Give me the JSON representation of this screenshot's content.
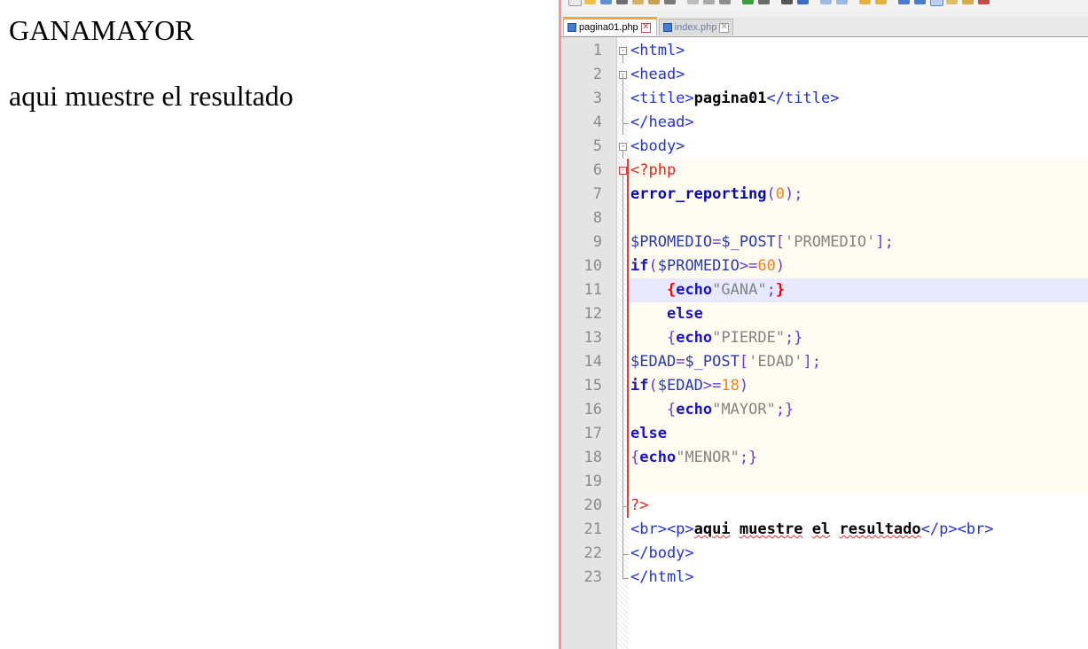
{
  "browser": {
    "output_text": "GANAMAYOR",
    "paragraph": "aqui muestre el resultado"
  },
  "editor": {
    "tabs": [
      {
        "label": "pagina01.php",
        "active": true
      },
      {
        "label": "index.php",
        "active": false
      }
    ],
    "close_glyph": "✕",
    "lines": [
      {
        "n": "1",
        "tokens": [
          [
            "tag",
            "<html>"
          ]
        ]
      },
      {
        "n": "2",
        "tokens": [
          [
            "tag",
            "<head>"
          ]
        ]
      },
      {
        "n": "3",
        "tokens": [
          [
            "tag",
            "<title>"
          ],
          [
            "bold",
            "pagina01"
          ],
          [
            "tag",
            "</title>"
          ]
        ]
      },
      {
        "n": "4",
        "tokens": [
          [
            "tag",
            "</head>"
          ]
        ]
      },
      {
        "n": "5",
        "tokens": [
          [
            "tag",
            "<body>"
          ]
        ]
      },
      {
        "n": "6",
        "tokens": [
          [
            "php",
            "<?php"
          ]
        ]
      },
      {
        "n": "7",
        "tokens": [
          [
            "fn",
            "error_reporting"
          ],
          [
            "op",
            "("
          ],
          [
            "num",
            "0"
          ],
          [
            "op",
            ");"
          ]
        ]
      },
      {
        "n": "8",
        "tokens": []
      },
      {
        "n": "9",
        "tokens": [
          [
            "var",
            "$PROMEDIO"
          ],
          [
            "op",
            "="
          ],
          [
            "var",
            "$_POST"
          ],
          [
            "op",
            "["
          ],
          [
            "str",
            "'PROMEDIO'"
          ],
          [
            "op",
            "];"
          ]
        ]
      },
      {
        "n": "10",
        "tokens": [
          [
            "kw",
            "if"
          ],
          [
            "op",
            "("
          ],
          [
            "var",
            "$PROMEDIO"
          ],
          [
            "op",
            ">="
          ],
          [
            "num",
            "60"
          ],
          [
            "op",
            ")"
          ]
        ]
      },
      {
        "n": "11",
        "tokens": [
          [
            "plain",
            "    "
          ],
          [
            "brace-red",
            "{"
          ],
          [
            "kw",
            "echo"
          ],
          [
            "str",
            "\"GANA\""
          ],
          [
            "op",
            ";"
          ],
          [
            "brace-red",
            "}"
          ]
        ]
      },
      {
        "n": "12",
        "tokens": [
          [
            "plain",
            "    "
          ],
          [
            "kw",
            "else"
          ]
        ]
      },
      {
        "n": "13",
        "tokens": [
          [
            "plain",
            "    "
          ],
          [
            "op",
            "{"
          ],
          [
            "kw",
            "echo"
          ],
          [
            "str",
            "\"PIERDE\""
          ],
          [
            "op",
            ";}"
          ]
        ]
      },
      {
        "n": "14",
        "tokens": [
          [
            "var",
            "$EDAD"
          ],
          [
            "op",
            "="
          ],
          [
            "var",
            "$_POST"
          ],
          [
            "op",
            "["
          ],
          [
            "str",
            "'EDAD'"
          ],
          [
            "op",
            "];"
          ]
        ]
      },
      {
        "n": "15",
        "tokens": [
          [
            "kw",
            "if"
          ],
          [
            "op",
            "("
          ],
          [
            "var",
            "$EDAD"
          ],
          [
            "op",
            ">="
          ],
          [
            "num",
            "18"
          ],
          [
            "op",
            ")"
          ]
        ]
      },
      {
        "n": "16",
        "tokens": [
          [
            "plain",
            "    "
          ],
          [
            "op",
            "{"
          ],
          [
            "kw",
            "echo"
          ],
          [
            "str",
            "\"MAYOR\""
          ],
          [
            "op",
            ";}"
          ]
        ]
      },
      {
        "n": "17",
        "tokens": [
          [
            "kw",
            "else"
          ]
        ]
      },
      {
        "n": "18",
        "tokens": [
          [
            "op",
            "{"
          ],
          [
            "kw",
            "echo"
          ],
          [
            "str",
            "\"MENOR\""
          ],
          [
            "op",
            ";}"
          ]
        ]
      },
      {
        "n": "19",
        "tokens": []
      },
      {
        "n": "20",
        "tokens": [
          [
            "php",
            "?>"
          ]
        ]
      },
      {
        "n": "21",
        "tokens": [
          [
            "tag",
            "<br><p>"
          ],
          [
            "bold squiggle",
            "aqui"
          ],
          [
            "bold",
            " "
          ],
          [
            "bold squiggle",
            "muestre"
          ],
          [
            "bold",
            " "
          ],
          [
            "bold squiggle",
            "el"
          ],
          [
            "bold",
            " "
          ],
          [
            "bold squiggle",
            "resultado"
          ],
          [
            "tag",
            "</p><br>"
          ]
        ]
      },
      {
        "n": "22",
        "tokens": [
          [
            "tag",
            "</body>"
          ]
        ]
      },
      {
        "n": "23",
        "tokens": [
          [
            "tag",
            "</html>"
          ]
        ]
      }
    ]
  }
}
